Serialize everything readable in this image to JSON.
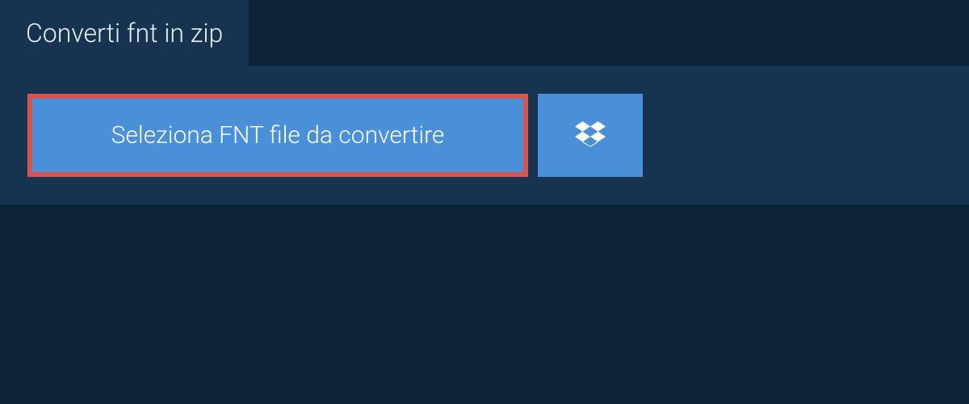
{
  "tab": {
    "title": "Converti fnt in zip"
  },
  "actions": {
    "select_file_label": "Seleziona FNT file da convertire"
  }
}
